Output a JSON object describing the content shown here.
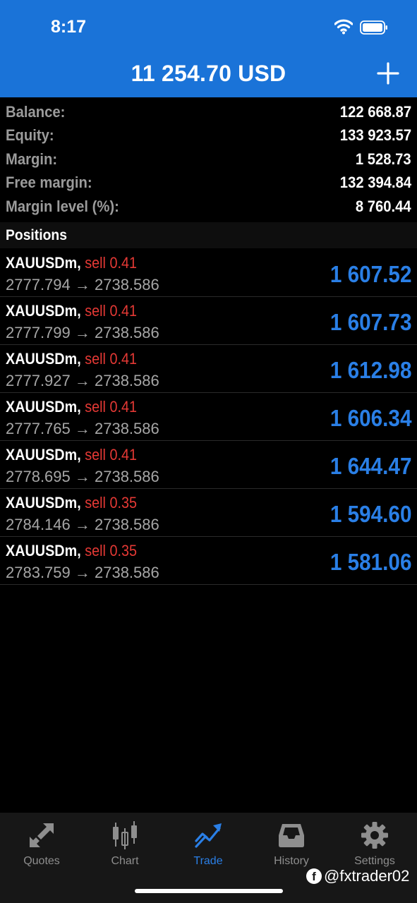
{
  "status_bar": {
    "time": "8:17"
  },
  "header": {
    "title": "11 254.70 USD"
  },
  "summary": [
    {
      "label": "Balance:",
      "value": "122 668.87"
    },
    {
      "label": "Equity:",
      "value": "133 923.57"
    },
    {
      "label": "Margin:",
      "value": "1 528.73"
    },
    {
      "label": "Free margin:",
      "value": "132 394.84"
    },
    {
      "label": "Margin level (%):",
      "value": "8 760.44"
    }
  ],
  "positions": {
    "title": "Positions",
    "items": [
      {
        "symbol": "XAUUSDm,",
        "side": "sell 0.41",
        "prices": "2777.794 → 2738.586",
        "profit": "1 607.52"
      },
      {
        "symbol": "XAUUSDm,",
        "side": "sell 0.41",
        "prices": "2777.799 → 2738.586",
        "profit": "1 607.73"
      },
      {
        "symbol": "XAUUSDm,",
        "side": "sell 0.41",
        "prices": "2777.927 → 2738.586",
        "profit": "1 612.98"
      },
      {
        "symbol": "XAUUSDm,",
        "side": "sell 0.41",
        "prices": "2777.765 → 2738.586",
        "profit": "1 606.34"
      },
      {
        "symbol": "XAUUSDm,",
        "side": "sell 0.41",
        "prices": "2778.695 → 2738.586",
        "profit": "1 644.47"
      },
      {
        "symbol": "XAUUSDm,",
        "side": "sell 0.35",
        "prices": "2784.146 → 2738.586",
        "profit": "1 594.60"
      },
      {
        "symbol": "XAUUSDm,",
        "side": "sell 0.35",
        "prices": "2783.759 → 2738.586",
        "profit": "1 581.06"
      }
    ]
  },
  "tabs": [
    {
      "label": "Quotes",
      "icon": "quotes-arrows-icon"
    },
    {
      "label": "Chart",
      "icon": "candlestick-icon"
    },
    {
      "label": "Trade",
      "icon": "trend-up-icon",
      "active": true
    },
    {
      "label": "History",
      "icon": "inbox-tray-icon"
    },
    {
      "label": "Settings",
      "icon": "gear-icon"
    }
  ],
  "watermark": "@fxtrader02",
  "colors": {
    "header": "#1a73d8",
    "profit": "#2a7fe6",
    "sell": "#e53935",
    "label": "#9b9b9b"
  }
}
